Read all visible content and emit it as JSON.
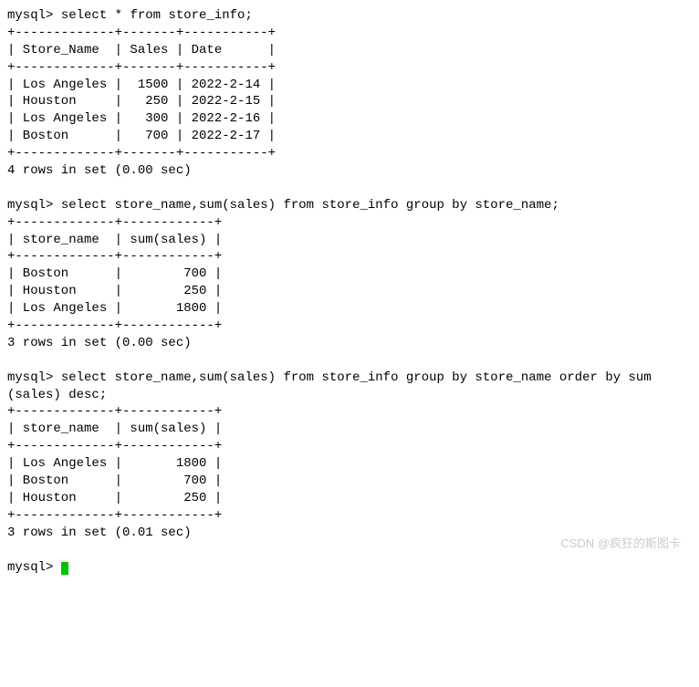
{
  "queries": [
    {
      "prompt": "mysql>",
      "sql": "select * from store_info;",
      "table": {
        "border1": "+-------------+-------+-----------+",
        "header": "| Store_Name  | Sales | Date      |",
        "border2": "+-------------+-------+-----------+",
        "rows": [
          "| Los Angeles |  1500 | 2022-2-14 |",
          "| Houston     |   250 | 2022-2-15 |",
          "| Los Angeles |   300 | 2022-2-16 |",
          "| Boston      |   700 | 2022-2-17 |"
        ],
        "border3": "+-------------+-------+-----------+"
      },
      "summary": "4 rows in set (0.00 sec)"
    },
    {
      "prompt": "mysql>",
      "sql": "select store_name,sum(sales) from store_info group by store_name;",
      "table": {
        "border1": "+-------------+------------+",
        "header": "| store_name  | sum(sales) |",
        "border2": "+-------------+------------+",
        "rows": [
          "| Boston      |        700 |",
          "| Houston     |        250 |",
          "| Los Angeles |       1800 |"
        ],
        "border3": "+-------------+------------+"
      },
      "summary": "3 rows in set (0.00 sec)"
    },
    {
      "prompt": "mysql>",
      "sql": "select store_name,sum(sales) from store_info group by store_name order by sum\n(sales) desc;",
      "table": {
        "border1": "+-------------+------------+",
        "header": "| store_name  | sum(sales) |",
        "border2": "+-------------+------------+",
        "rows": [
          "| Los Angeles |       1800 |",
          "| Boston      |        700 |",
          "| Houston     |        250 |"
        ],
        "border3": "+-------------+------------+"
      },
      "summary": "3 rows in set (0.01 sec)"
    }
  ],
  "final_prompt": "mysql>",
  "watermark": "CSDN @疯狂的斯图卡"
}
